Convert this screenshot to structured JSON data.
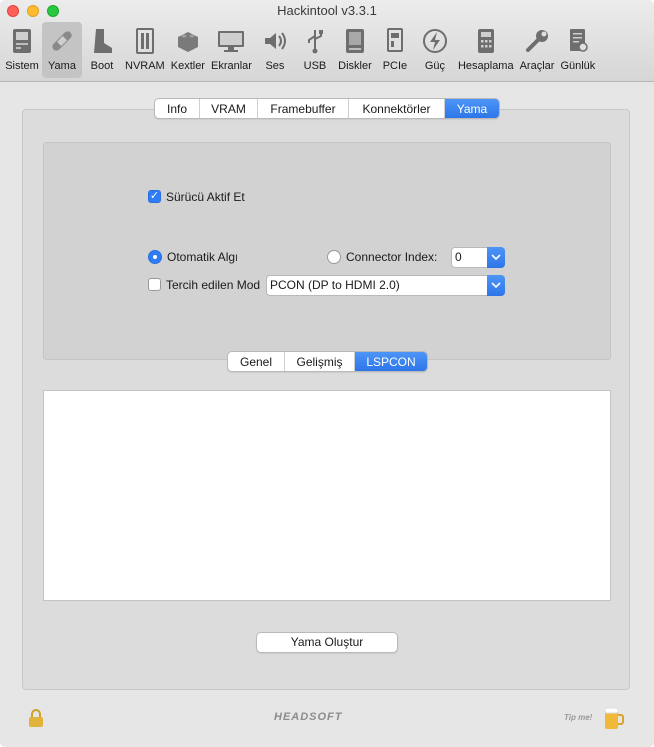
{
  "window": {
    "title": "Hackintool v3.3.1"
  },
  "toolbar": {
    "items": [
      {
        "label": "Sistem",
        "icon": "computer-icon"
      },
      {
        "label": "Yama",
        "icon": "bandage-icon",
        "active": true
      },
      {
        "label": "Boot",
        "icon": "boot-icon"
      },
      {
        "label": "NVRAM",
        "icon": "nvram-chip-icon"
      },
      {
        "label": "Kextler",
        "icon": "lego-brick-icon"
      },
      {
        "label": "Ekranlar",
        "icon": "monitor-icon"
      },
      {
        "label": "Ses",
        "icon": "speaker-icon"
      },
      {
        "label": "USB",
        "icon": "usb-icon"
      },
      {
        "label": "Diskler",
        "icon": "disk-icon"
      },
      {
        "label": "PCIe",
        "icon": "pcie-card-icon"
      },
      {
        "label": "Güç",
        "icon": "power-bolt-icon"
      },
      {
        "label": "Hesaplama",
        "icon": "calculator-icon"
      },
      {
        "label": "Araçlar",
        "icon": "wrench-icon"
      },
      {
        "label": "Günlük",
        "icon": "log-document-icon"
      }
    ]
  },
  "top_tabs": {
    "items": [
      "Info",
      "VRAM",
      "Framebuffer",
      "Konnektörler",
      "Yama"
    ],
    "selected": "Yama"
  },
  "lspcon": {
    "driver_enable_label": "Sürücü Aktif Et",
    "driver_enable_checked": true,
    "auto_detect_label": "Otomatik Algıla",
    "auto_detect_selected": true,
    "connector_index_label": "Connector Index:",
    "connector_index_value": "0",
    "preferred_mode_label": "Tercih edilen Mod",
    "preferred_mode_checked": false,
    "preferred_mode_value": "PCON (DP to HDMI 2.0)"
  },
  "bottom_tabs": {
    "items": [
      "Genel",
      "Gelişmiş",
      "LSPCON"
    ],
    "selected": "LSPCON"
  },
  "output": {
    "text": ""
  },
  "actions": {
    "generate_patch_label": "Yama Oluştur"
  },
  "footer": {
    "brand": "HEADSOFT",
    "tip": "Tip me!"
  },
  "colors": {
    "accent": "#2f7cf6",
    "window_bg": "#e6e6e6",
    "panel_bg": "#dcdcdc"
  }
}
